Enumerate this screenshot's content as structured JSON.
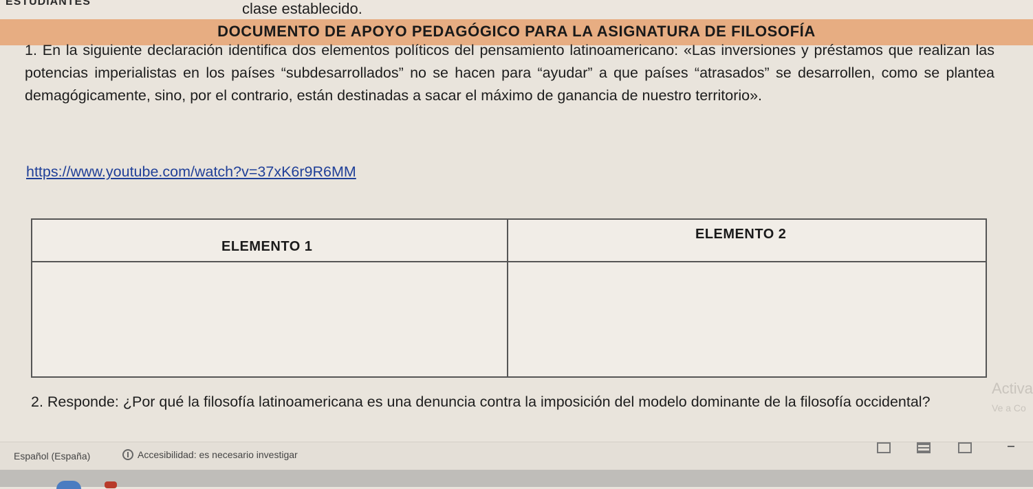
{
  "header": {
    "top_left_word": "ESTUDIANTES",
    "top_sentence": "clase establecido."
  },
  "document": {
    "title": "DOCUMENTO DE APOYO PEDAGÓGICO PARA LA ASIGNATURA DE FILOSOFÍA",
    "question1": "1. En la siguiente declaración identifica dos elementos políticos del pensamiento latinoamericano: «Las inversiones y préstamos que realizan las potencias imperialistas en los países “subdesarrollados” no se hacen para “ayudar” a que países “atrasados” se desarrollen, como se plantea demagógicamente, sino, por el contrario, están destinadas a sacar el máximo de ganancia de nuestro territorio».",
    "link": "https://www.youtube.com/watch?v=37xK6r9R6MM",
    "table": {
      "headers": [
        "ELEMENTO 1",
        "ELEMENTO 2"
      ]
    },
    "question2": "2. Responde: ¿Por qué la filosofía latinoamericana es una denuncia contra la imposición del modelo dominante de la filosofía occidental?"
  },
  "watermark": {
    "line1": "Activa",
    "line2": "Ve a Co"
  },
  "status_bar": {
    "language": "Español (España)",
    "accessibility": "Accesibilidad: es necesario investigar"
  }
}
